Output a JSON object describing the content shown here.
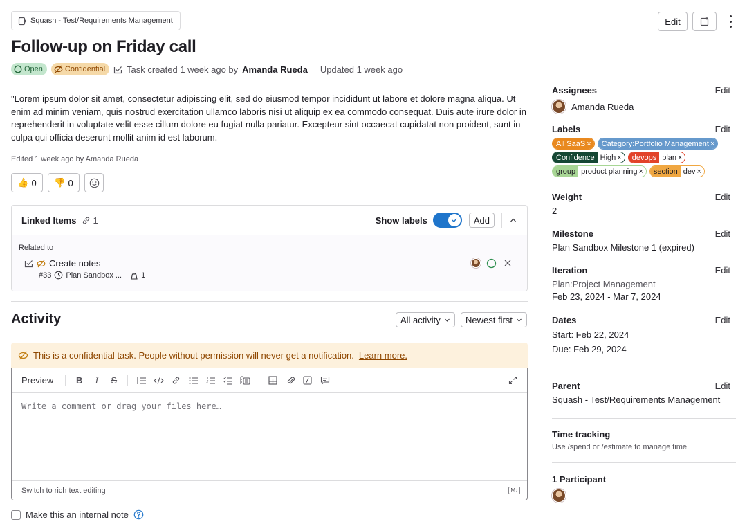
{
  "header": {
    "breadcrumb": "Squash - Test/Requirements Management",
    "title": "Follow-up on Friday call",
    "status_open": "Open",
    "status_confidential": "Confidential",
    "meta_created": "Task created 1 week ago by",
    "meta_author": "Amanda Rueda",
    "meta_updated": "Updated 1 week ago",
    "edit_label": "Edit"
  },
  "description": {
    "text": "\"Lorem ipsum dolor sit amet, consectetur adipiscing elit, sed do eiusmod tempor incididunt ut labore et dolore magna aliqua. Ut enim ad minim veniam, quis nostrud exercitation ullamco laboris nisi ut aliquip ex ea commodo consequat. Duis aute irure dolor in reprehenderit in voluptate velit esse cillum dolore eu fugiat nulla pariatur. Excepteur sint occaecat cupidatat non proident, sunt in culpa qui officia deserunt mollit anim id est laborum.",
    "edited": "Edited 1 week ago by Amanda Rueda"
  },
  "reactions": {
    "thumbs_up": "0",
    "thumbs_down": "0"
  },
  "linked_items": {
    "title": "Linked Items",
    "count": "1",
    "show_labels": "Show labels",
    "add_label": "Add",
    "group": "Related to",
    "item_title": "Create notes",
    "item_ref": "#33",
    "item_iteration": "Plan Sandbox ...",
    "item_weight": "1"
  },
  "activity": {
    "title": "Activity",
    "filter": "All activity",
    "sort": "Newest first",
    "warning": "This is a confidential task. People without permission will never get a notification.",
    "learn_more": "Learn more.",
    "preview_tab": "Preview",
    "placeholder": "Write a comment or drag your files here…",
    "switch_rich": "Switch to rich text editing",
    "md_badge": "M↓",
    "internal_note": "Make this an internal note"
  },
  "sidebar": {
    "edit": "Edit",
    "assignees_title": "Assignees",
    "assignee": "Amanda Rueda",
    "labels_title": "Labels",
    "labels": [
      {
        "key": "All SaaS",
        "value": "",
        "color": "#e9891f"
      },
      {
        "key": "Category:Portfolio Management",
        "value": "",
        "color": "#6699cc"
      },
      {
        "key": "Confidence",
        "value": "High",
        "color": "#154734"
      },
      {
        "key": "devops",
        "value": "plan",
        "color": "#e24329"
      },
      {
        "key": "group",
        "value": "product planning",
        "color": "#a8d695"
      },
      {
        "key": "section",
        "value": "dev",
        "color": "#f0a741"
      }
    ],
    "weight_title": "Weight",
    "weight": "2",
    "milestone_title": "Milestone",
    "milestone": "Plan Sandbox Milestone 1 (expired)",
    "iteration_title": "Iteration",
    "iteration_cadence": "Plan:Project Management",
    "iteration_dates": "Feb 23, 2024 - Mar 7, 2024",
    "dates_title": "Dates",
    "start": "Start: Feb 22, 2024",
    "due": "Due: Feb 29, 2024",
    "parent_title": "Parent",
    "parent": "Squash - Test/Requirements Management",
    "time_title": "Time tracking",
    "time_hint": "Use /spend or /estimate to manage time.",
    "participants": "1 Participant"
  }
}
